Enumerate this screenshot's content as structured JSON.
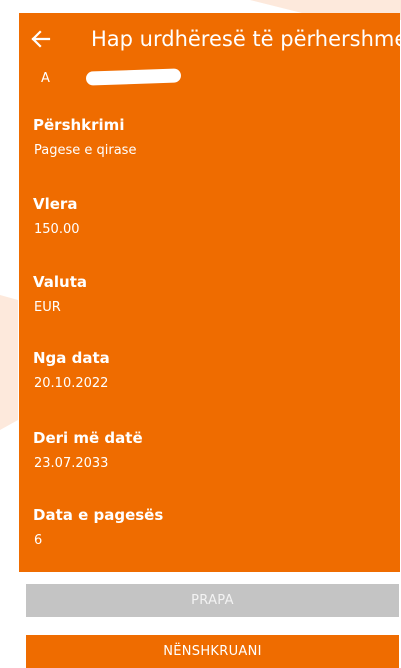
{
  "colors": {
    "accent": "#ef6c00",
    "disabled": "#c4c4c4",
    "text_on_accent": "#ffffff"
  },
  "header": {
    "title": "Hap urdhëresë të përhershme",
    "back_icon": "arrow-left-icon"
  },
  "account": {
    "partial_text": "A"
  },
  "fields": [
    {
      "label": "Përshkrimi",
      "value": "Pagese e qirase"
    },
    {
      "label": "Vlera",
      "value": "150.00"
    },
    {
      "label": "Valuta",
      "value": "EUR"
    },
    {
      "label": "Nga data",
      "value": "20.10.2022"
    },
    {
      "label": "Deri më datë",
      "value": "23.07.2033"
    },
    {
      "label": "Data e pagesës",
      "value": "6"
    }
  ],
  "buttons": {
    "back_label": "PRAPA",
    "sign_label": "NËNSHKRUANI"
  }
}
